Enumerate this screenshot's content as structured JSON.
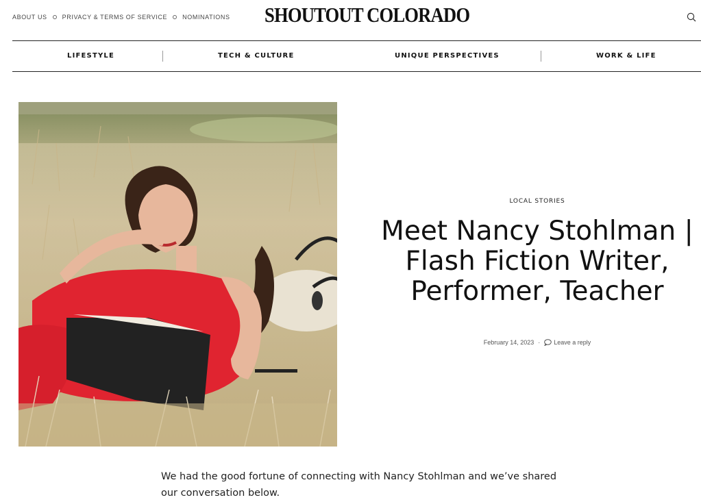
{
  "top_links": [
    "ABOUT US",
    "PRIVACY & TERMS OF SERVICE",
    "NOMINATIONS"
  ],
  "logo": "SHOUTOUT COLORADO",
  "nav": [
    "LIFESTYLE",
    "TECH & CULTURE",
    "UNIQUE PERSPECTIVES",
    "WORK & LIFE"
  ],
  "article": {
    "category": "LOCAL STORIES",
    "title": "Meet Nancy Stohlman | Flash Fiction Writer, Performer, Teacher",
    "date": "February 14, 2023",
    "separator": "·",
    "reply_label": "Leave a reply",
    "intro": "We had the good fortune of connecting with Nancy Stohlman and we’ve shared our conversation below."
  },
  "icons": {
    "search": "search-icon",
    "comment": "comment-icon"
  },
  "colors": {
    "text": "#111111",
    "muted": "#555555",
    "dress": "#e02430",
    "grass": "#c9b98e"
  }
}
